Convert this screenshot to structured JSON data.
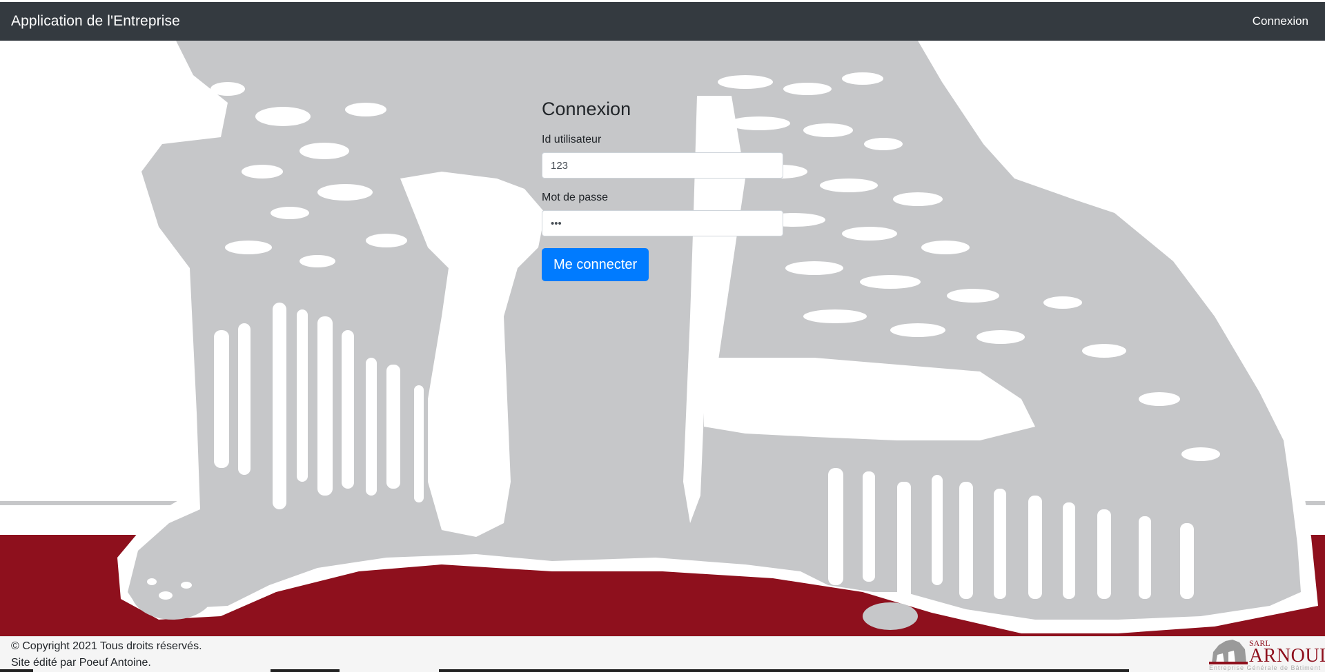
{
  "navbar": {
    "brand": "Application de l'Entreprise",
    "login_link": "Connexion"
  },
  "login": {
    "title": "Connexion",
    "user_id_label": "Id utilisateur",
    "user_id_value": "123",
    "password_label": "Mot de passe",
    "password_value": "•••",
    "submit_label": "Me connecter"
  },
  "footer": {
    "copyright": "© Copyright 2021 Tous droits réservés.",
    "credit": "Site édité par Poeuf Antoine.",
    "logo": {
      "small_text": "SARL",
      "name": "ARNOULT",
      "tagline": "Entreprise Générale de Bâtiment"
    }
  },
  "colors": {
    "navbar_bg": "#343a40",
    "primary_button": "#007bff",
    "brand_red": "#8e101d",
    "illustration_grey": "#c6c7c9",
    "footer_bg": "#f5f5f5"
  }
}
